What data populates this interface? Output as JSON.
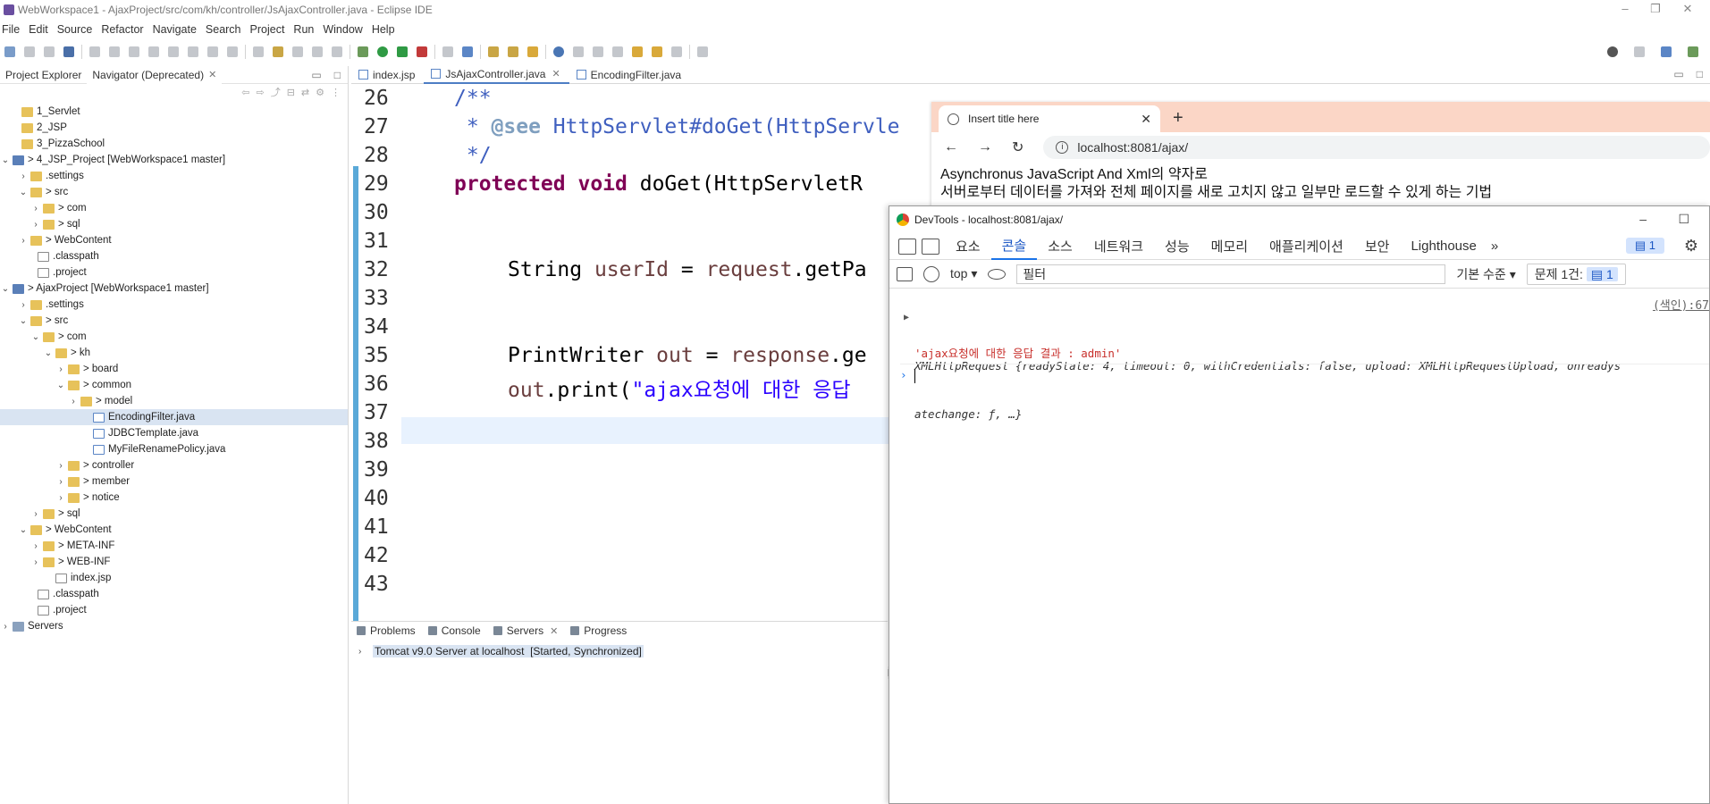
{
  "window": {
    "title": "WebWorkspace1 - AjaxProject/src/com/kh/controller/JsAjaxController.java - Eclipse IDE",
    "minimize": "–",
    "maximize": "❐",
    "close": "✕"
  },
  "menu": [
    "File",
    "Edit",
    "Source",
    "Refactor",
    "Navigate",
    "Search",
    "Project",
    "Run",
    "Window",
    "Help"
  ],
  "left_panel": {
    "tabs": [
      {
        "label": "Project Explorer"
      },
      {
        "label": "Navigator (Deprecated)",
        "close": "✕"
      }
    ],
    "tree": [
      {
        "label": "1_Servlet",
        "icon": "folder",
        "twisty": ""
      },
      {
        "label": "2_JSP",
        "icon": "folder",
        "twisty": ""
      },
      {
        "label": "3_PizzaSchool",
        "icon": "folder",
        "twisty": ""
      },
      {
        "label": "> 4_JSP_Project [WebWorkspace1 master]",
        "icon": "project",
        "twisty": "⌄"
      },
      {
        "label": ".settings",
        "icon": "folder",
        "twisty": "›"
      },
      {
        "label": "> src",
        "icon": "folder",
        "twisty": "⌄"
      },
      {
        "label": "> com",
        "icon": "folder",
        "twisty": "›"
      },
      {
        "label": "> sql",
        "icon": "folder",
        "twisty": "›"
      },
      {
        "label": "> WebContent",
        "icon": "folder",
        "twisty": "›"
      },
      {
        "label": ".classpath",
        "icon": "file",
        "twisty": ""
      },
      {
        "label": ".project",
        "icon": "file",
        "twisty": ""
      },
      {
        "label": "> AjaxProject [WebWorkspace1 master]",
        "icon": "project",
        "twisty": "⌄"
      },
      {
        "label": ".settings",
        "icon": "folder",
        "twisty": "›"
      },
      {
        "label": "> src",
        "icon": "folder",
        "twisty": "⌄"
      },
      {
        "label": "> com",
        "icon": "folder",
        "twisty": "⌄"
      },
      {
        "label": "> kh",
        "icon": "folder",
        "twisty": "⌄"
      },
      {
        "label": "> board",
        "icon": "folder",
        "twisty": "›"
      },
      {
        "label": "> common",
        "icon": "folder",
        "twisty": "⌄"
      },
      {
        "label": "> model",
        "icon": "folder",
        "twisty": "›"
      },
      {
        "label": "EncodingFilter.java",
        "icon": "java",
        "twisty": "",
        "selected": true
      },
      {
        "label": "JDBCTemplate.java",
        "icon": "java",
        "twisty": ""
      },
      {
        "label": "MyFileRenamePolicy.java",
        "icon": "java",
        "twisty": ""
      },
      {
        "label": "> controller",
        "icon": "folder",
        "twisty": "›"
      },
      {
        "label": "> member",
        "icon": "folder",
        "twisty": "›"
      },
      {
        "label": "> notice",
        "icon": "folder",
        "twisty": "›"
      },
      {
        "label": "> sql",
        "icon": "folder",
        "twisty": "›"
      },
      {
        "label": "> WebContent",
        "icon": "folder",
        "twisty": "⌄"
      },
      {
        "label": "> META-INF",
        "icon": "folder",
        "twisty": "›"
      },
      {
        "label": "> WEB-INF",
        "icon": "folder",
        "twisty": "›"
      },
      {
        "label": "index.jsp",
        "icon": "file",
        "twisty": ""
      },
      {
        "label": ".classpath",
        "icon": "file",
        "twisty": ""
      },
      {
        "label": ".project",
        "icon": "file",
        "twisty": ""
      },
      {
        "label": "Servers",
        "icon": "server",
        "twisty": "›"
      }
    ]
  },
  "editor": {
    "tabs": [
      {
        "label": "index.jsp"
      },
      {
        "label": "JsAjaxController.java",
        "active": true,
        "close": "✕"
      },
      {
        "label": "EncodingFilter.java"
      }
    ],
    "line_numbers": [
      "26",
      "27",
      "28",
      "29",
      "30",
      "31",
      "32",
      "33",
      "34",
      "35",
      "36",
      "37",
      "38",
      "39",
      "40",
      "41",
      "42",
      "43"
    ],
    "code": {
      "l27": "/**",
      "l28_star": " * ",
      "l28_tag": "@see",
      "l28_link": " HttpServlet#doGet(HttpServle",
      "l29": " */",
      "l30_kw1": "protected",
      "l30_kw2": "void",
      "l30_rest": " doGet(HttpServletR",
      "l33_type": "String ",
      "l33_var": "userId",
      "l33_eq": " = ",
      "l33_req": "request",
      "l33_rest": ".getPa",
      "l36_type": "PrintWriter ",
      "l36_var": "out",
      "l36_eq": " = ",
      "l36_resp": "response",
      "l36_rest": ".ge",
      "l37_var": "out",
      "l37_mid": ".print(",
      "l37_str": "\"ajax요청에 대한 응답"
    }
  },
  "bottom_panel": {
    "tabs": [
      {
        "label": "Problems"
      },
      {
        "label": "Console"
      },
      {
        "label": "Servers",
        "active": true,
        "close": "✕"
      },
      {
        "label": "Progress"
      }
    ],
    "server": {
      "name": "Tomcat v9.0 Server at localhost",
      "state": "[Started, Synchronized]"
    }
  },
  "browser": {
    "tab_title": "Insert title here",
    "tab_close": "✕",
    "new_tab": "+",
    "url": "localhost:8081/ajax/",
    "nav": {
      "back": "←",
      "forward": "→",
      "reload": "↻"
    },
    "content": [
      "Asynchronus JavaScript And Xml의 약자로",
      "서버로부터 데이터를 가져와 전체 페이지를 새로 고치지 않고 일부만 로드할 수 있게 하는 기법"
    ]
  },
  "devtools": {
    "title": "DevTools - localhost:8081/ajax/",
    "tabs": [
      "요소",
      "콘솔",
      "소스",
      "네트워크",
      "성능",
      "메모리",
      "애플리케이션",
      "보안",
      "Lighthouse"
    ],
    "more": "»",
    "active_tab": "콘솔",
    "badge": "1",
    "context": "top ▾",
    "filter_placeholder": "필터",
    "levels": "기본 수준 ▾",
    "issues_label": "문제 1건:",
    "issues_count": "1",
    "log_location": "(색인):67",
    "log_object": "XMLHttpRequest {readyState: 4, timeout: 0, withCredentials: false, upload: XMLHttpRequestUpload, onreadystatechange: ƒ, …}",
    "log_object_l1": "XMLHttpRequest {readyState: 4, timeout: 0, withCredentials: false, upload: XMLHttpRequestUpload, onreadys",
    "log_object_l2": "atechange: ƒ, …}",
    "log_string": "'ajax요청에 대한 응답 결과 : admin'",
    "prompt": "›"
  },
  "colors": {
    "ruler": "#5aa9d8",
    "keyword": "#7f0055",
    "string": "#2a00ff",
    "comment": "#3f5fbf",
    "browser_tabbar": "#fbd6c6",
    "accent": "#1a73e8"
  }
}
